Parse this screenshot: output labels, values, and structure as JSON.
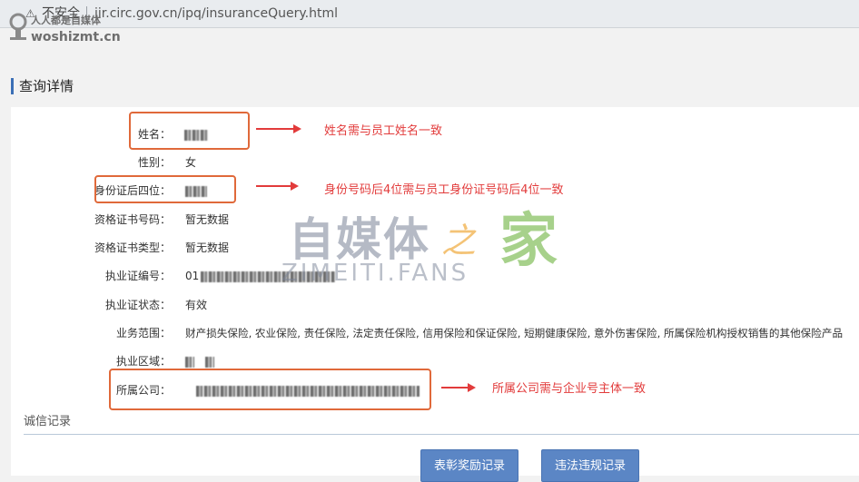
{
  "browser": {
    "warning_glyph": "⚠",
    "insecure_label": "不安全",
    "url": "iir.circ.gov.cn/ipq/insuranceQuery.html"
  },
  "source_watermark": {
    "line1": "人人都是自媒体",
    "line2": "woshizmt.cn"
  },
  "section": {
    "title": "查询详情"
  },
  "fields": [
    {
      "label": "姓名：",
      "value": ""
    },
    {
      "label": "性别：",
      "value": "女"
    },
    {
      "label": "身份证后四位：",
      "value": ""
    },
    {
      "label": "资格证书号码：",
      "value": "暂无数据"
    },
    {
      "label": "资格证书类型：",
      "value": "暂无数据"
    },
    {
      "label": "执业证编号：",
      "value": "01"
    },
    {
      "label": "执业证状态：",
      "value": "有效"
    },
    {
      "label": "业务范围：",
      "value": "财产损失保险, 农业保险, 责任保险, 法定责任保险, 信用保险和保证保险, 短期健康保险, 意外伤害保险, 所属保险机构授权销售的其他保险产品"
    },
    {
      "label": "执业区域：",
      "value": ""
    },
    {
      "label": "所属公司：",
      "value": ""
    }
  ],
  "notes": {
    "name": "姓名需与员工姓名一致",
    "id": "身份号码后4位需与员工身份证号码后4位一致",
    "company": "所属公司需与企业号主体一致"
  },
  "credit": {
    "title": "诚信记录"
  },
  "buttons": {
    "awards": "表彰奖励记录",
    "violations": "违法违规记录"
  },
  "watermark": {
    "main": "自媒体",
    "connector": "之",
    "home": "家",
    "sub": "ZIMEITI.FANS"
  },
  "colors": {
    "accent": "#3b6fb6",
    "highlight_box": "#e0693a",
    "annotation": "#e23b3b",
    "button": "#5b86c5"
  }
}
